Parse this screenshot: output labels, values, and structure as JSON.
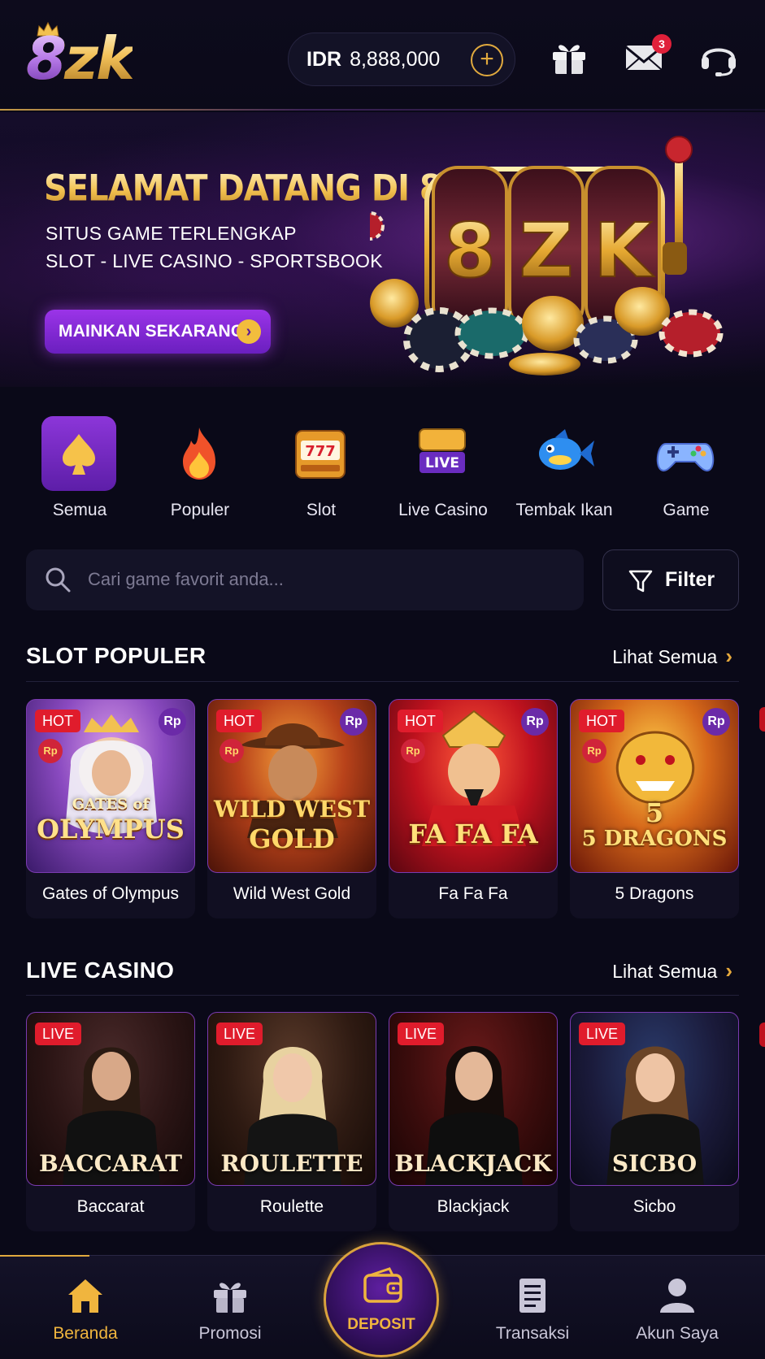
{
  "header": {
    "logo_text": "8zk",
    "currency": "IDR",
    "balance": "8,888,000",
    "add_symbol": "+",
    "mail_count": "3"
  },
  "banner": {
    "title": "SELAMAT DATANG DI 8ZK",
    "line1": "SITUS GAME TERLENGKAP",
    "line2": "SLOT - LIVE CASINO - SPORTSBOOK",
    "cta": "MAINKAN SEKARANG",
    "reel_symbols": [
      "8",
      "Z",
      "K"
    ]
  },
  "categories": [
    {
      "label": "Semua",
      "icon": "spade-icon",
      "active": true
    },
    {
      "label": "Populer",
      "icon": "fire-icon"
    },
    {
      "label": "Slot",
      "icon": "slot-machine-icon",
      "icon_text": "777"
    },
    {
      "label": "Live Casino",
      "icon": "live-casino-icon",
      "icon_text": "LIVE"
    },
    {
      "label": "Tembak Ikan",
      "icon": "fish-icon"
    },
    {
      "label": "Game",
      "icon": "gamepad-icon"
    }
  ],
  "search": {
    "placeholder": "Cari game favorit anda...",
    "value": ""
  },
  "filter_label": "Filter",
  "slot_section": {
    "title": "SLOT POPULER",
    "more": "Lihat Semua",
    "games": [
      {
        "name": "Gates of Olympus",
        "art_line1": "GATES of",
        "art_line2": "OLYMPUS",
        "badge": "HOT",
        "currency_badge": "Rp"
      },
      {
        "name": "Wild West Gold",
        "art_line1": "WILD WEST",
        "art_line2": "GOLD",
        "badge": "HOT",
        "currency_badge": "Rp"
      },
      {
        "name": "Fa Fa Fa",
        "art_line1": "",
        "art_line2": "FA FA FA",
        "badge": "HOT",
        "currency_badge": "Rp"
      },
      {
        "name": "5 Dragons",
        "art_line1": "5",
        "art_line2": "5 DRAGONS",
        "badge": "HOT",
        "currency_badge": "Rp"
      }
    ]
  },
  "live_section": {
    "title": "LIVE CASINO",
    "more": "Lihat Semua",
    "games": [
      {
        "name": "Baccarat",
        "art": "BACCARAT",
        "badge": "LIVE"
      },
      {
        "name": "Roulette",
        "art": "ROULETTE",
        "badge": "LIVE"
      },
      {
        "name": "Blackjack",
        "art": "BLACKJACK",
        "badge": "LIVE"
      },
      {
        "name": "Sicbo",
        "art": "SICBO",
        "badge": "LIVE"
      }
    ]
  },
  "bottom_nav": {
    "home": "Beranda",
    "promo": "Promosi",
    "deposit": "DEPOSIT",
    "transactions": "Transaksi",
    "account": "Akun Saya"
  },
  "colors": {
    "background": "#0a0918",
    "accent_gold": "#f0b53e",
    "accent_purple": "#8c36d9",
    "hot_red": "#e01c2c"
  }
}
